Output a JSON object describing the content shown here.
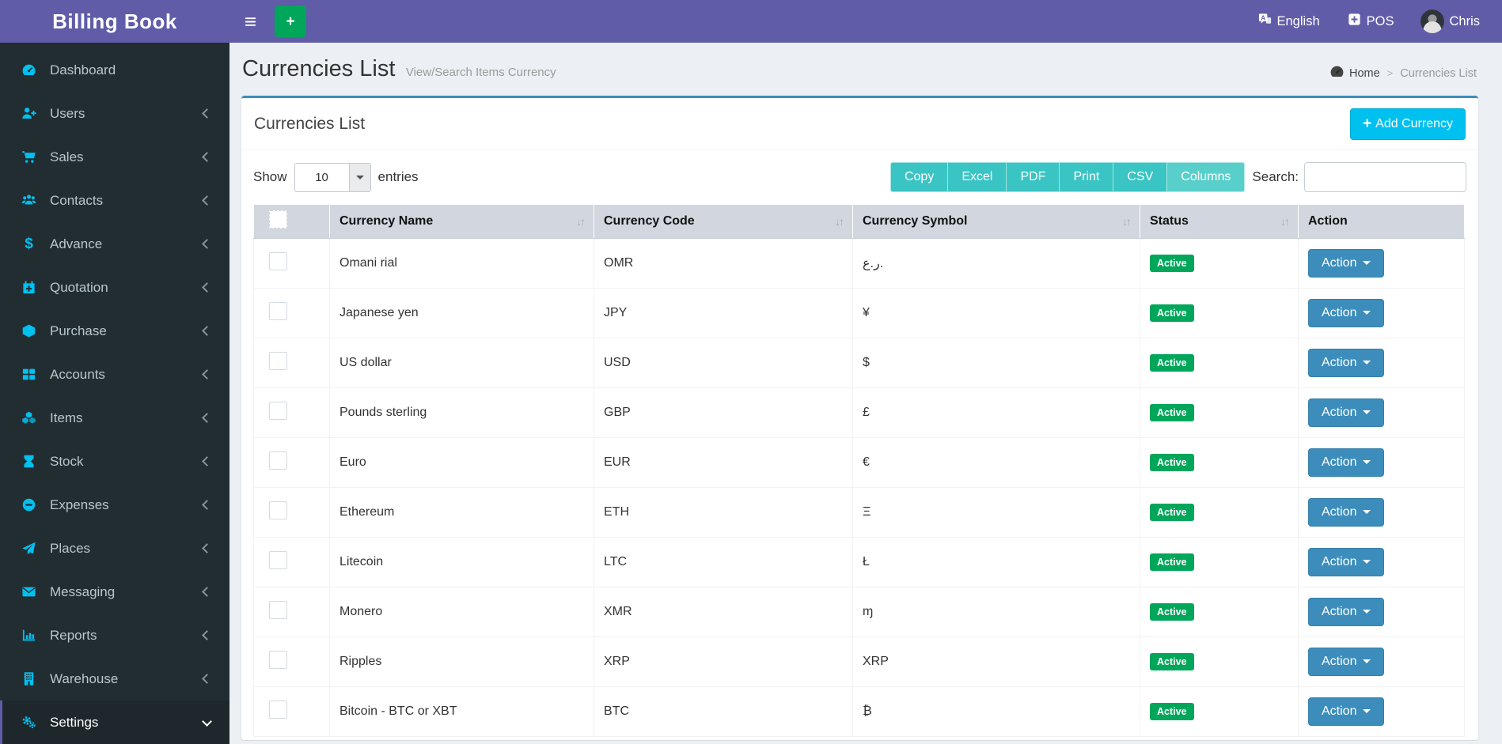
{
  "colors": {
    "purple": "#605ca8",
    "sidebar_bg": "#222d32",
    "sidebar_active_bg": "#1e282c",
    "sidebar_text": "#b8c7ce",
    "cyan": "#00c0ef",
    "green": "#00a65a",
    "content_bg": "#ecf0f5",
    "card_top": "#3c8dbc",
    "action_blue": "#3c8dbc",
    "teal": "#3ac4c4",
    "teal_light": "#58cfcb",
    "th_bg": "#d2d6de"
  },
  "app": {
    "title": "Billing Book"
  },
  "topbar": {
    "hamburger_icon": "hamburger-icon",
    "quick_add_icon": "plus-icon",
    "language": {
      "label": "English",
      "icon": "language-icon"
    },
    "pos": {
      "label": "POS",
      "icon": "plus-square-icon"
    },
    "user": {
      "name": "Chris",
      "icon": "avatar"
    }
  },
  "sidebar": {
    "items": [
      {
        "label": "Dashboard",
        "icon": "gauge-icon",
        "chevron": "none"
      },
      {
        "label": "Users",
        "icon": "user-plus-icon",
        "chevron": "left"
      },
      {
        "label": "Sales",
        "icon": "cart-icon",
        "chevron": "left"
      },
      {
        "label": "Contacts",
        "icon": "users-icon",
        "chevron": "left"
      },
      {
        "label": "Advance",
        "icon": "dollar-icon",
        "chevron": "left"
      },
      {
        "label": "Quotation",
        "icon": "calendar-plus-icon",
        "chevron": "left"
      },
      {
        "label": "Purchase",
        "icon": "cube-icon",
        "chevron": "left"
      },
      {
        "label": "Accounts",
        "icon": "grid-icon",
        "chevron": "left"
      },
      {
        "label": "Items",
        "icon": "cubes-icon",
        "chevron": "left"
      },
      {
        "label": "Stock",
        "icon": "hourglass-icon",
        "chevron": "left"
      },
      {
        "label": "Expenses",
        "icon": "minus-circle-icon",
        "chevron": "left"
      },
      {
        "label": "Places",
        "icon": "paper-plane-icon",
        "chevron": "left"
      },
      {
        "label": "Messaging",
        "icon": "envelope-icon",
        "chevron": "left"
      },
      {
        "label": "Reports",
        "icon": "bar-chart-icon",
        "chevron": "left"
      },
      {
        "label": "Warehouse",
        "icon": "building-icon",
        "chevron": "left"
      },
      {
        "label": "Settings",
        "icon": "gears-icon",
        "chevron": "down",
        "active": true
      }
    ]
  },
  "page": {
    "title": "Currencies List",
    "subtitle": "View/Search Items Currency",
    "breadcrumb": {
      "home_icon": "gauge-icon",
      "home_label": "Home",
      "separator": ">",
      "current": "Currencies List"
    }
  },
  "panel": {
    "title": "Currencies List",
    "add_button_icon": "plus-icon",
    "add_button_label": "Add Currency"
  },
  "controls": {
    "show_label": "Show",
    "page_size": "10",
    "entries_label": "entries",
    "export_buttons": [
      {
        "label": "Copy"
      },
      {
        "label": "Excel"
      },
      {
        "label": "PDF"
      },
      {
        "label": "Print"
      },
      {
        "label": "CSV"
      },
      {
        "label": "Columns",
        "active": true
      }
    ],
    "search_label": "Search:",
    "search_value": ""
  },
  "table": {
    "sort_icon": "sort-icon",
    "action_label": "Action",
    "headers": [
      {
        "label": "Currency Name",
        "sortable": true
      },
      {
        "label": "Currency Code",
        "sortable": true
      },
      {
        "label": "Currency Symbol",
        "sortable": true
      },
      {
        "label": "Status",
        "sortable": true
      },
      {
        "label": "Action",
        "sortable": false
      }
    ],
    "rows": [
      {
        "name": "Omani rial",
        "code": "OMR",
        "symbol": "ر.ع.",
        "status": "Active"
      },
      {
        "name": "Japanese yen",
        "code": "JPY",
        "symbol": "¥",
        "status": "Active"
      },
      {
        "name": "US dollar",
        "code": "USD",
        "symbol": "$",
        "status": "Active"
      },
      {
        "name": "Pounds sterling",
        "code": "GBP",
        "symbol": "£",
        "status": "Active"
      },
      {
        "name": "Euro",
        "code": "EUR",
        "symbol": "€",
        "status": "Active"
      },
      {
        "name": "Ethereum",
        "code": "ETH",
        "symbol": "Ξ",
        "status": "Active"
      },
      {
        "name": "Litecoin",
        "code": "LTC",
        "symbol": "Ł",
        "status": "Active"
      },
      {
        "name": "Monero",
        "code": "XMR",
        "symbol": "ɱ",
        "status": "Active"
      },
      {
        "name": "Ripples",
        "code": "XRP",
        "symbol": "XRP",
        "status": "Active"
      },
      {
        "name": "Bitcoin - BTC or XBT",
        "code": "BTC",
        "symbol": "₿",
        "status": "Active"
      }
    ]
  }
}
